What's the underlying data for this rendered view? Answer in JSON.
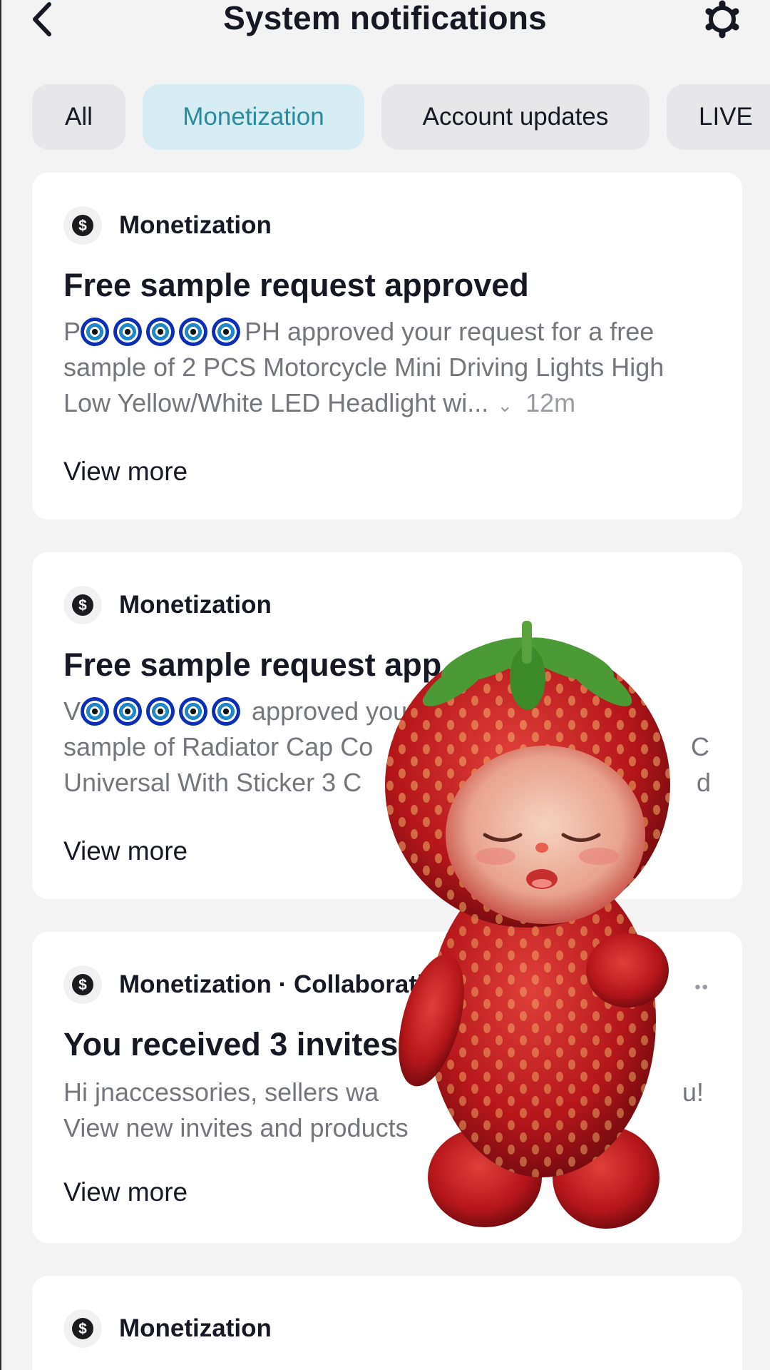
{
  "header": {
    "title": "System notifications",
    "back_icon": "chevron-left-icon",
    "settings_icon": "gear-icon"
  },
  "tabs": [
    {
      "label": "All",
      "active": false
    },
    {
      "label": "Monetization",
      "active": true
    },
    {
      "label": "Account updates",
      "active": false
    },
    {
      "label": "LIVE",
      "active": false
    }
  ],
  "colors": {
    "active_tab_bg": "#d6edf3",
    "active_tab_text": "#2c8aa0",
    "card_bg": "#ffffff",
    "page_bg": "#f3f3f4"
  },
  "cards": [
    {
      "category": "Monetization",
      "icon": "dollar-icon",
      "title": "Free sample request approved",
      "body_prefix": "P",
      "body_suffix": "PH approved your request for a free sample of 2 PCS Motorcycle Mini Driving Lights High Low Yellow/White LED Headlight wi...",
      "time": "12m",
      "view_more": "View more"
    },
    {
      "category": "Monetization",
      "icon": "dollar-icon",
      "title": "Free sample request app",
      "body_prefix": "V",
      "body_suffix": "approved your",
      "body_line2": "sample of Radiator Cap Co",
      "body_line2_tail": "C",
      "body_line3": "Universal With Sticker 3 C",
      "body_line3_tail": "d",
      "view_more": "View more"
    },
    {
      "category": "Monetization · Collaboratio",
      "icon": "dollar-icon",
      "title": "You received 3 invites",
      "body_line1": "Hi jnaccessories, sellers wa",
      "body_line1_tail": "u!",
      "body_line2": "View new invites and products",
      "view_more": "View more"
    },
    {
      "category": "Monetization",
      "icon": "dollar-icon"
    }
  ]
}
